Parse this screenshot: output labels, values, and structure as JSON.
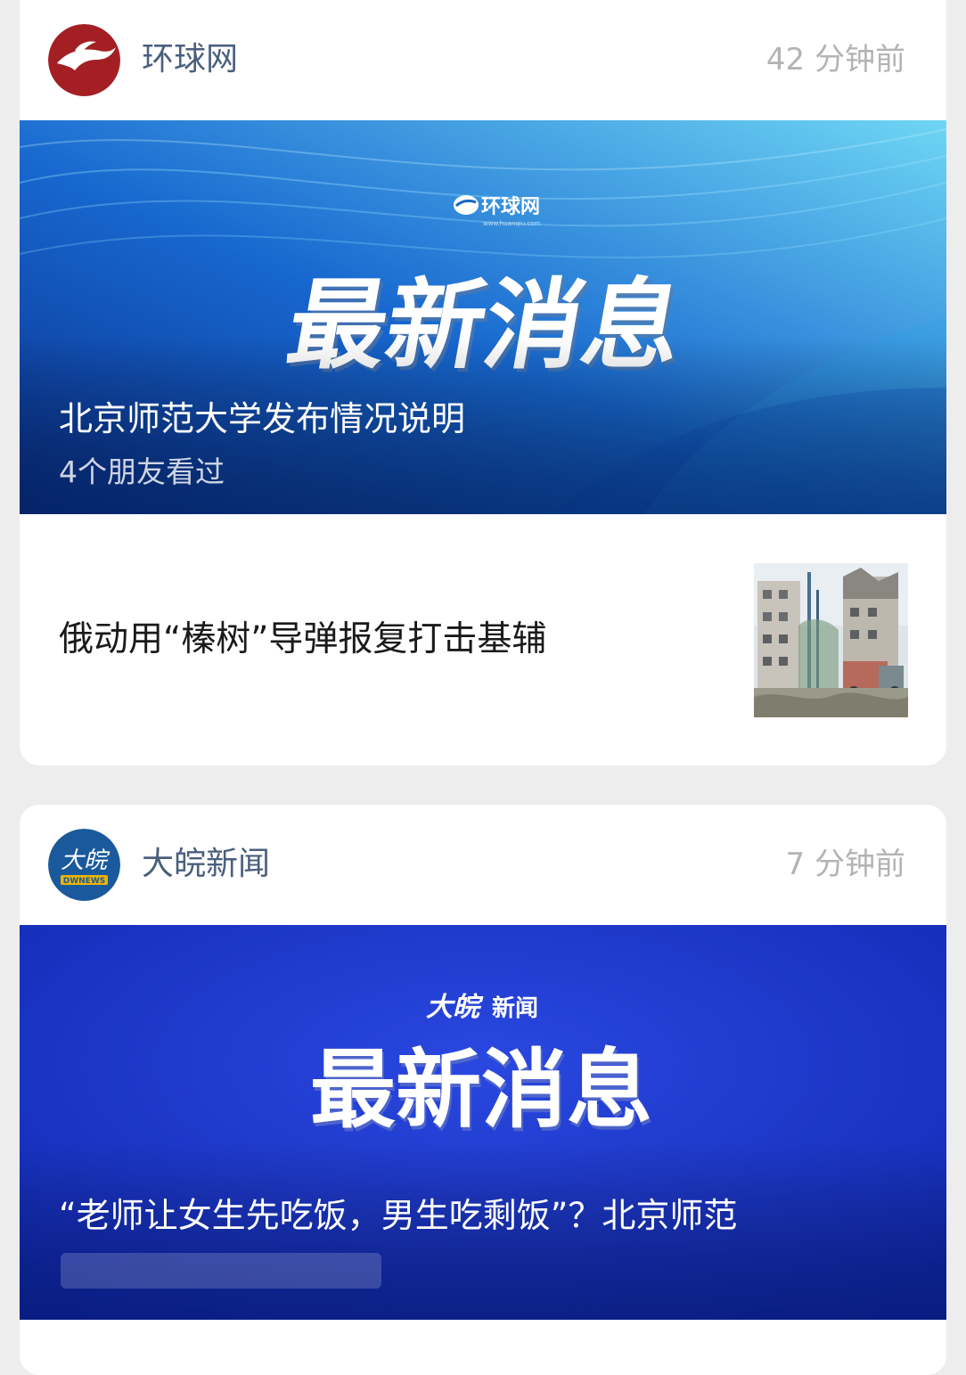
{
  "cards": [
    {
      "source": "环球网",
      "time": "42 分钟前",
      "banner": {
        "logo_text": "环球网",
        "headline": "最新消息",
        "title": "北京师范大学发布情况说明",
        "subtitle": "4个朋友看过"
      },
      "article": {
        "title": "俄动用“榛树”导弹报复打击基辅"
      },
      "colors": {
        "brand": "#a31f24",
        "banner_dark": "#0b3d9e",
        "banner_light": "#5ec8ee"
      }
    },
    {
      "source": "大皖新闻",
      "time": "7 分钟前",
      "banner": {
        "logo_text": "大皖新闻",
        "headline": "最新消息",
        "title": "“老师让女生先吃饭，男生吃剩饭”？北京师范"
      },
      "colors": {
        "brand": "#1a5a9c",
        "banner": "#1631c8"
      }
    }
  ]
}
